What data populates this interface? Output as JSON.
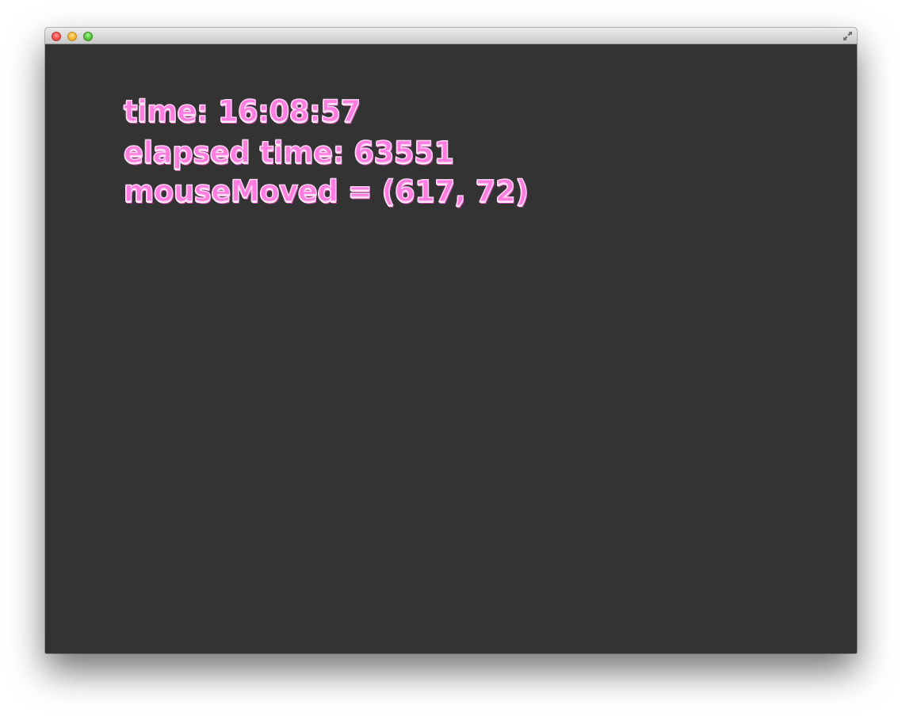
{
  "window": {
    "title": "",
    "controls": {
      "close": "close-icon",
      "minimize": "minimize-icon",
      "zoom": "zoom-icon",
      "fullscreen": "fullscreen-icon"
    }
  },
  "canvas": {
    "background_color": "#333333",
    "text_color": "#ff7be0",
    "lines": [
      "time: 16:08:57",
      "elapsed time: 63551",
      "mouseMoved = (617, 72)"
    ]
  }
}
